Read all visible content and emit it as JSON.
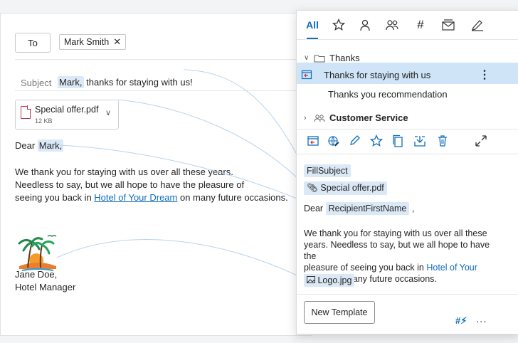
{
  "compose": {
    "to_label": "To",
    "recipient": "Mark Smith",
    "subject_label": "Subject",
    "subject_name": "Mark,",
    "subject_rest": " thanks for staying with us!",
    "attachment": {
      "name": "Special offer.pdf",
      "size": "12 KB"
    },
    "greeting_prefix": "Dear ",
    "greeting_name": "Mark,",
    "body_line1": "We thank you for staying with us over all these years.",
    "body_line2": "Needless to say, but we all hope to have the pleasure of",
    "body_line3_prefix": "seeing you back in ",
    "hotel_link": "Hotel of Your Dream",
    "body_line3_suffix": " on many future occasions.",
    "signature_name": "Jane Doe,",
    "signature_title": "Hotel Manager"
  },
  "panel": {
    "tabs": [
      {
        "label": "All",
        "icon": ""
      },
      {
        "label": "",
        "icon": "star-icon"
      },
      {
        "label": "",
        "icon": "person-icon"
      },
      {
        "label": "",
        "icon": "people-icon"
      },
      {
        "label": "",
        "icon": "hash-icon"
      },
      {
        "label": "",
        "icon": "mail-stack-icon"
      },
      {
        "label": "",
        "icon": "signature-icon"
      }
    ],
    "folder_thanks": "Thanks",
    "template_selected": "Thanks for staying with us",
    "template_second": "Thanks you recommendation",
    "folder_service": "Customer Service",
    "fill_subject": "FillSubject",
    "attach_token": "Special offer.pdf",
    "dear_prefix": "Dear",
    "recipient_token": "RecipientFirstName",
    "dear_suffix": ",",
    "preview_line1": "We thank you for staying with us over all these",
    "preview_line2": "years. Needless to say, but we all hope to have the",
    "preview_line3_prefix": "pleasure of seeing you back in ",
    "preview_link": "Hotel of Your Dream",
    "preview_line4_suffix": " on many future occasions.",
    "logo_token": "Logo.jpg",
    "new_template": "New Template",
    "more": "...",
    "accent": "#0f6cbd",
    "highlight": "#dbe9f7"
  }
}
